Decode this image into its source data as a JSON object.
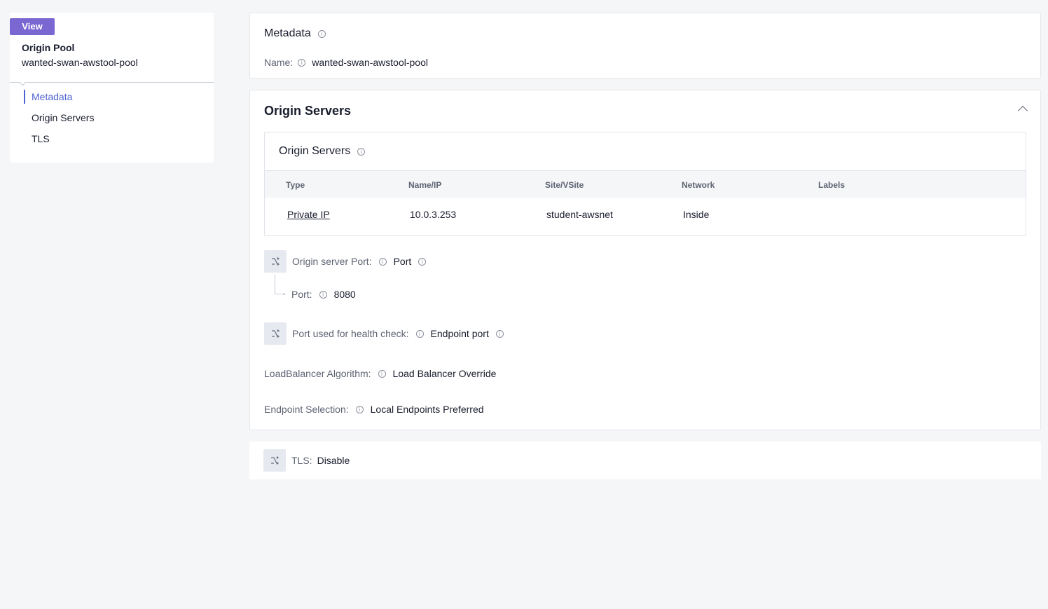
{
  "sidebar": {
    "badge": "View",
    "object_type": "Origin Pool",
    "object_name": "wanted-swan-awstool-pool",
    "nav": [
      {
        "label": "Metadata",
        "active": true
      },
      {
        "label": "Origin Servers",
        "active": false
      },
      {
        "label": "TLS",
        "active": false
      }
    ]
  },
  "metadata": {
    "title": "Metadata",
    "name_label": "Name:",
    "name_value": "wanted-swan-awstool-pool"
  },
  "origin_servers": {
    "title": "Origin Servers",
    "table_title": "Origin Servers",
    "columns": [
      "Type",
      "Name/IP",
      "Site/VSite",
      "Network",
      "Labels"
    ],
    "rows": [
      {
        "type": "Private IP",
        "name_ip": "10.0.3.253",
        "site": "student-awsnet",
        "network": "Inside",
        "labels": ""
      }
    ],
    "origin_port_label": "Origin server Port:",
    "origin_port_value": "Port",
    "port_label": "Port:",
    "port_value": "8080",
    "health_check_label": "Port used for health check:",
    "health_check_value": "Endpoint port",
    "lb_algorithm_label": "LoadBalancer Algorithm:",
    "lb_algorithm_value": "Load Balancer Override",
    "endpoint_selection_label": "Endpoint Selection:",
    "endpoint_selection_value": "Local Endpoints Preferred"
  },
  "tls": {
    "label": "TLS:",
    "value": "Disable"
  },
  "colors": {
    "accent": "#4e63d1",
    "badge": "#7a67d1",
    "background": "#f5f6f8"
  }
}
